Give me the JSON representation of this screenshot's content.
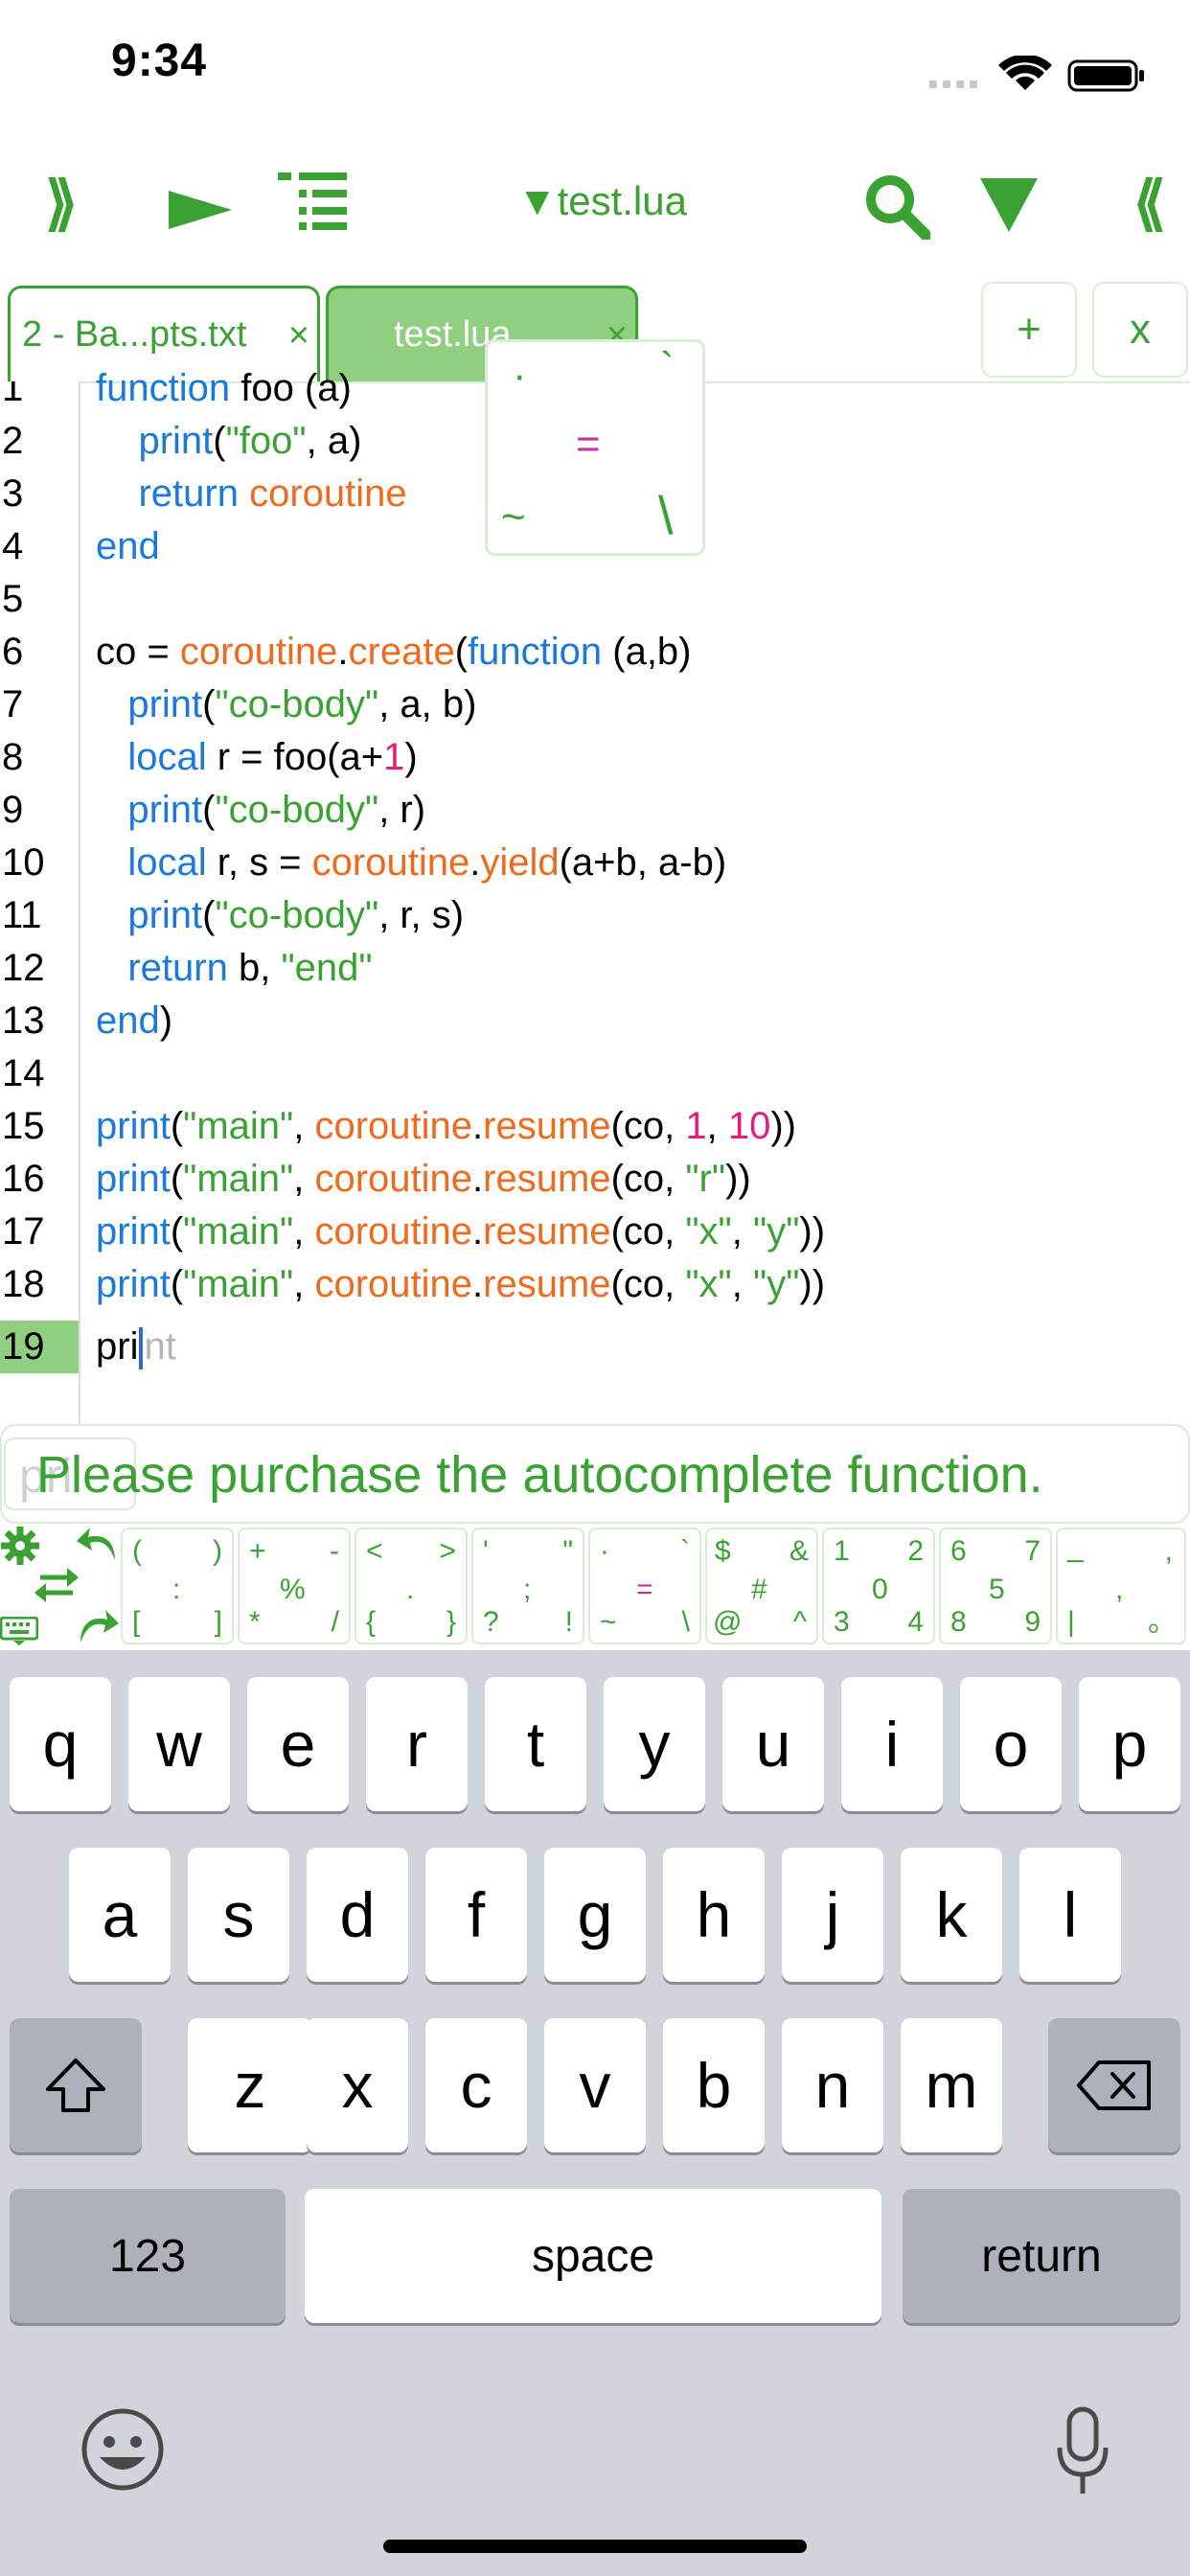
{
  "status_bar": {
    "time": "9:34"
  },
  "toolbar": {
    "left_expand_icon": "⟫",
    "run_icon": "▶",
    "outline_icon": "list-icon",
    "file_title": "▼test.lua",
    "search_icon": "🔍",
    "dropdown_icon": "▼",
    "right_collapse_icon": "⟪"
  },
  "tabs": [
    {
      "label": "2 - Ba...pts.txt",
      "close": "×"
    },
    {
      "label": "test.lua",
      "close": "×"
    }
  ],
  "tab_actions": {
    "add": "+",
    "close_all": "x"
  },
  "editor": {
    "line_numbers": [
      "1",
      "2",
      "3",
      "4",
      "5",
      "6",
      "7",
      "8",
      "9",
      "10",
      "11",
      "12",
      "13",
      "14",
      "15",
      "16",
      "17",
      "18",
      "19"
    ],
    "active_line": "19",
    "current_typed": "pri",
    "current_ghost": "nt"
  },
  "symbol_popup": {
    "top_left": "·",
    "top_right": "`",
    "center": "=",
    "bottom_left": "~",
    "bottom_right": "\\"
  },
  "autocomplete": {
    "ghost": "pri",
    "message": "Please purchase the autocomplete function."
  },
  "symbol_bar": {
    "keys": [
      {
        "tl": "(",
        "tr": ")",
        "c": ":",
        "bl": "[",
        "br": "]"
      },
      {
        "tl": "+",
        "tr": "-",
        "c": "%",
        "bl": "*",
        "br": "/"
      },
      {
        "tl": "<",
        "tr": ">",
        "c": ".",
        "bl": "{",
        "br": "}"
      },
      {
        "tl": "'",
        "tr": "\"",
        "c": ";",
        "bl": "?",
        "br": "!"
      },
      {
        "tl": "·",
        "tr": "`",
        "c": "=",
        "bl": "~",
        "br": "\\"
      },
      {
        "tl": "$",
        "tr": "&",
        "c": "#",
        "bl": "@",
        "br": "^"
      },
      {
        "tl": "1",
        "tr": "2",
        "c": "0",
        "bl": "3",
        "br": "4"
      },
      {
        "tl": "6",
        "tr": "7",
        "c": "5",
        "bl": "8",
        "br": "9"
      },
      {
        "tl": "_",
        "tr": ",",
        "c": ",",
        "bl": "|",
        "br": "。"
      }
    ]
  },
  "keyboard": {
    "row1": [
      "q",
      "w",
      "e",
      "r",
      "t",
      "y",
      "u",
      "i",
      "o",
      "p"
    ],
    "row2": [
      "a",
      "s",
      "d",
      "f",
      "g",
      "h",
      "j",
      "k",
      "l"
    ],
    "row3": [
      "z",
      "x",
      "c",
      "v",
      "b",
      "n",
      "m"
    ],
    "numbers": "123",
    "space": "space",
    "return": "return"
  }
}
